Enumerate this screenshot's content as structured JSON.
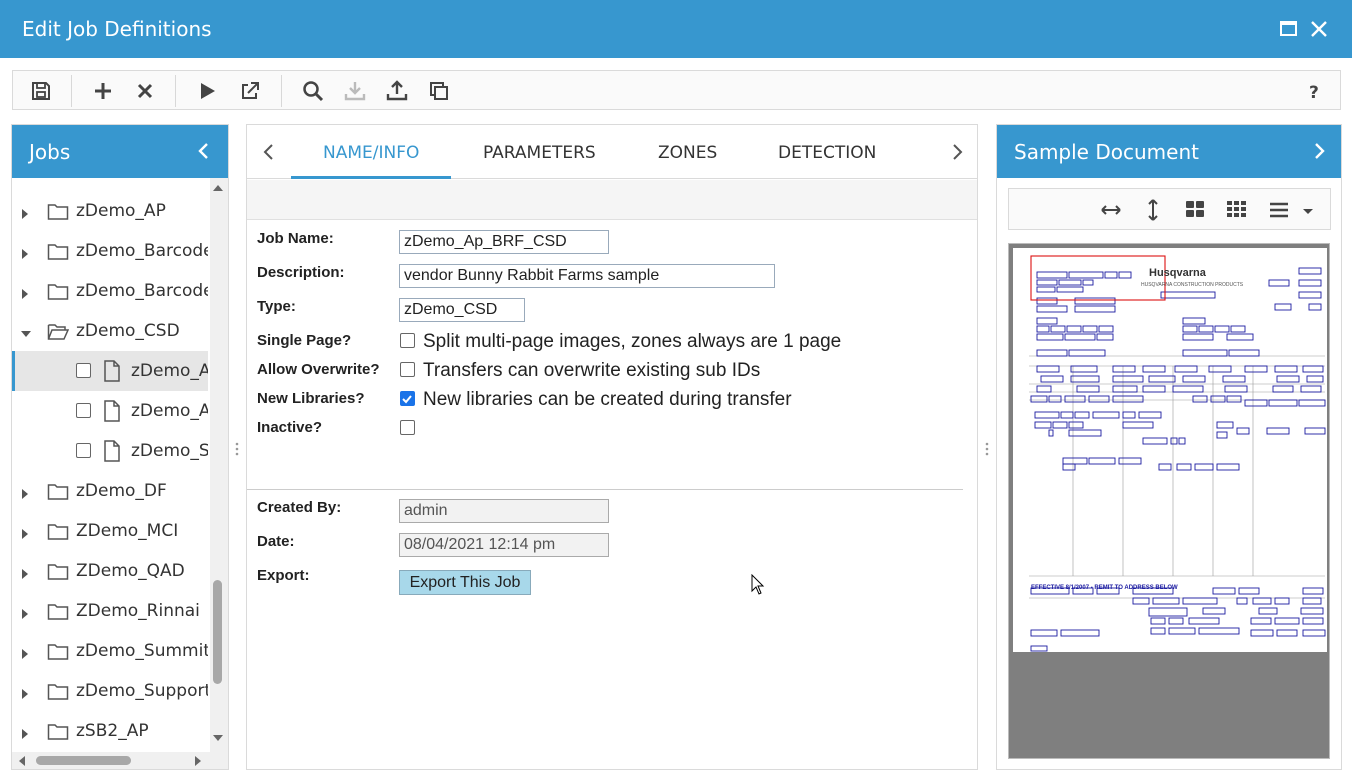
{
  "window": {
    "title": "Edit Job Definitions"
  },
  "toolbar": {
    "buttons": [
      "save-icon",
      "add-icon",
      "delete-icon",
      "run-icon",
      "open-external-icon",
      "search-icon",
      "import-icon",
      "export-icon",
      "copy-icon",
      "help-icon"
    ]
  },
  "jobs_panel": {
    "title": "Jobs",
    "tree": [
      {
        "label": "zDemo_AP",
        "type": "folder",
        "expanded": false
      },
      {
        "label": "zDemo_Barcode",
        "type": "folder",
        "expanded": false
      },
      {
        "label": "zDemo_Barcode_",
        "type": "folder",
        "expanded": false
      },
      {
        "label": "zDemo_CSD",
        "type": "folder",
        "expanded": true
      },
      {
        "label": "zDemo_Ap",
        "type": "job",
        "selected": true
      },
      {
        "label": "zDemo_Ap",
        "type": "job",
        "selected": false
      },
      {
        "label": "zDemo_Sx",
        "type": "job",
        "selected": false
      },
      {
        "label": "zDemo_DF",
        "type": "folder",
        "expanded": false
      },
      {
        "label": "ZDemo_MCI",
        "type": "folder",
        "expanded": false
      },
      {
        "label": "ZDemo_QAD",
        "type": "folder",
        "expanded": false
      },
      {
        "label": "ZDemo_Rinnai",
        "type": "folder",
        "expanded": false
      },
      {
        "label": "zDemo_Summit",
        "type": "folder",
        "expanded": false
      },
      {
        "label": "zDemo_Support",
        "type": "folder",
        "expanded": false
      },
      {
        "label": "zSB2_AP",
        "type": "folder",
        "expanded": false
      }
    ]
  },
  "tabs": {
    "items": [
      "NAME/INFO",
      "PARAMETERS",
      "ZONES",
      "DETECTION"
    ],
    "active": "NAME/INFO"
  },
  "form": {
    "job_name_label": "Job Name:",
    "job_name_value": "zDemo_Ap_BRF_CSD",
    "description_label": "Description:",
    "description_value": "vendor Bunny Rabbit Farms sample",
    "type_label": "Type:",
    "type_value": "zDemo_CSD",
    "single_page_label": "Single Page?",
    "single_page_text": "Split multi-page images, zones always are 1 page",
    "single_page_checked": false,
    "allow_overwrite_label": "Allow Overwrite?",
    "allow_overwrite_text": "Transfers can overwrite existing sub IDs",
    "allow_overwrite_checked": false,
    "new_libraries_label": "New Libraries?",
    "new_libraries_text": "New libraries can be created during transfer",
    "new_libraries_checked": true,
    "inactive_label": "Inactive?",
    "inactive_checked": false,
    "created_by_label": "Created By:",
    "created_by_value": "admin",
    "date_label": "Date:",
    "date_value": "08/04/2021 12:14 pm",
    "export_label": "Export:",
    "export_button": "Export This Job"
  },
  "sample_panel": {
    "title": "Sample Document",
    "viewer_buttons": [
      "fit-width-icon",
      "fit-height-icon",
      "grid-2x2-icon",
      "grid-3x3-icon",
      "list-menu-icon",
      "dropdown-caret-icon"
    ],
    "doc_logo": "Husqvarna",
    "doc_subtitle": "HUSQVARNA CONSTRUCTION PRODUCTS",
    "doc_remit": "EFFECTIVE 8/1/2007 - REMIT TO ADDRESS BELOW"
  },
  "colors": {
    "accent": "#3797cf",
    "zone": "#1a1aa0",
    "selected_zone": "#d11"
  }
}
